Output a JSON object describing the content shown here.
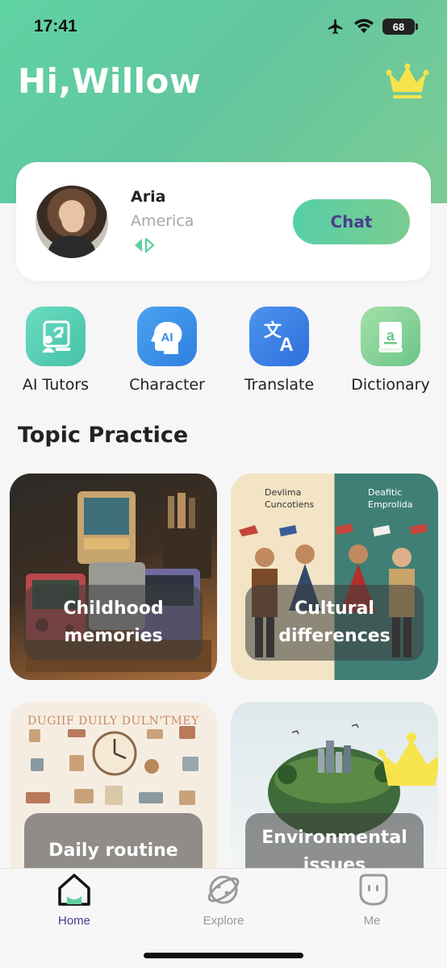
{
  "status_bar": {
    "time": "17:41",
    "battery": "68"
  },
  "header": {
    "greeting": "Hi,Willow"
  },
  "tutor_card": {
    "name": "Aria",
    "country": "America",
    "chat_label": "Chat"
  },
  "tools": [
    {
      "label": "AI Tutors",
      "icon": "ai-tutors-icon",
      "color": "#58cfb1"
    },
    {
      "label": "Character",
      "icon": "character-icon",
      "color": "#3d8de8"
    },
    {
      "label": "Translate",
      "icon": "translate-icon",
      "color": "#3c7de6"
    },
    {
      "label": "Dictionary",
      "icon": "dictionary-icon",
      "color": "#7ccc8f"
    }
  ],
  "topic_practice": {
    "title": "Topic Practice",
    "cards": [
      {
        "caption_line1": "Childhood",
        "caption_line2": "memories"
      },
      {
        "caption_line1": "Cultural",
        "caption_line2": "differences",
        "art_text_left_1": "Devlima",
        "art_text_left_2": "Cuncotiens",
        "art_text_right_1": "Deafitic",
        "art_text_right_2": "Emprolida"
      },
      {
        "caption_line1": "Daily routine",
        "art_text": "DUGIIF DUILY DULN'TMEY"
      },
      {
        "caption_line1": "Environmental",
        "caption_line2": "issues",
        "premium": true
      }
    ]
  },
  "bottom_nav": [
    {
      "label": "Home",
      "icon": "home-icon",
      "active": true
    },
    {
      "label": "Explore",
      "icon": "explore-icon",
      "active": false
    },
    {
      "label": "Me",
      "icon": "me-icon",
      "active": false
    }
  ],
  "colors": {
    "accent": "#5fd3a4",
    "nav_active": "#4b3e8a",
    "nav_inactive": "#9b9b9b",
    "crown": "#f7e44c"
  }
}
